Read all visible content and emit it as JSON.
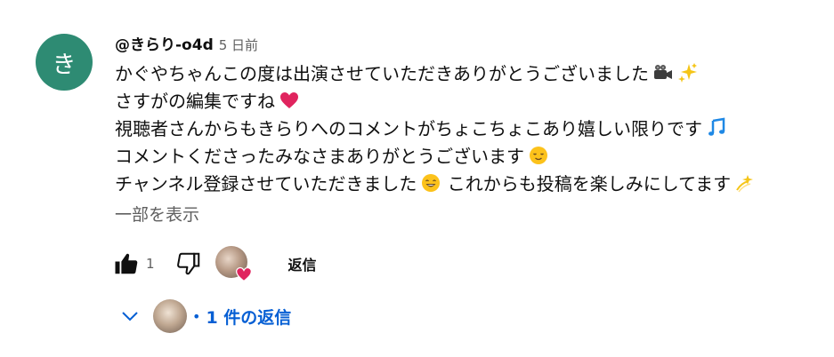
{
  "comment": {
    "avatar_letter": "き",
    "avatar_color": "#2e8b73",
    "author": "@きらり-o4d",
    "time": "5 日前",
    "lines": [
      {
        "text": "かぐやちゃんこの度は出演させていただきありがとうございました",
        "emojis": [
          "movie-camera-emoji",
          "sparkles-emoji"
        ]
      },
      {
        "text": "さすがの編集ですね",
        "emojis": [
          "red-heart-emoji"
        ]
      },
      {
        "text": "視聴者さんからもきらりへのコメントがちょこちょこあり嬉しい限りです",
        "emojis": [
          "musical-notes-emoji"
        ]
      },
      {
        "text": "コメントくださったみなさまありがとうございます",
        "emojis": [
          "relieved-face-emoji"
        ]
      },
      {
        "text": "チャンネル登録させていただきました",
        "emojis": [
          "grinning-face-emoji"
        ],
        "text2": "これからも投稿を楽しみにしてます",
        "emojis2": [
          "dizzy-emoji"
        ]
      }
    ],
    "show_less": "一部を表示"
  },
  "actions": {
    "like_icon": "thumb-up-filled-icon",
    "like_count": "1",
    "dislike_icon": "thumb-down-icon",
    "creator_heart": "creator-heart-icon",
    "reply_label": "返信"
  },
  "replies": {
    "toggle_icon": "chevron-down-icon",
    "dot": "•",
    "label": "1 件の返信"
  },
  "colors": {
    "link": "#065fd4",
    "secondary_text": "#606060",
    "heart": "#e0245e"
  }
}
